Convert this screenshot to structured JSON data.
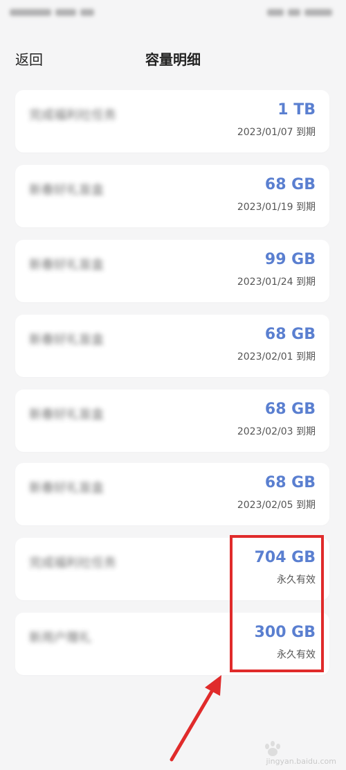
{
  "nav": {
    "back_label": "返回",
    "title": "容量明细"
  },
  "items": [
    {
      "name": "完成福利社任务",
      "amount": "1 TB",
      "expiry": "2023/01/07 到期"
    },
    {
      "name": "新春好礼盲盒",
      "amount": "68 GB",
      "expiry": "2023/01/19 到期"
    },
    {
      "name": "新春好礼盲盒",
      "amount": "99 GB",
      "expiry": "2023/01/24 到期"
    },
    {
      "name": "新春好礼盲盒",
      "amount": "68 GB",
      "expiry": "2023/02/01 到期"
    },
    {
      "name": "新春好礼盲盒",
      "amount": "68 GB",
      "expiry": "2023/02/03 到期"
    },
    {
      "name": "新春好礼盲盒",
      "amount": "68 GB",
      "expiry": "2023/02/05 到期"
    },
    {
      "name": "完成福利社任务",
      "amount": "704 GB",
      "expiry": "永久有效"
    },
    {
      "name": "新用户赠礼",
      "amount": "300 GB",
      "expiry": "永久有效"
    }
  ],
  "watermark": {
    "text": "jingyan.baidu.com"
  },
  "colors": {
    "accent": "#5a7fd0",
    "highlight": "#e02b2b",
    "background": "#f5f5f6"
  }
}
